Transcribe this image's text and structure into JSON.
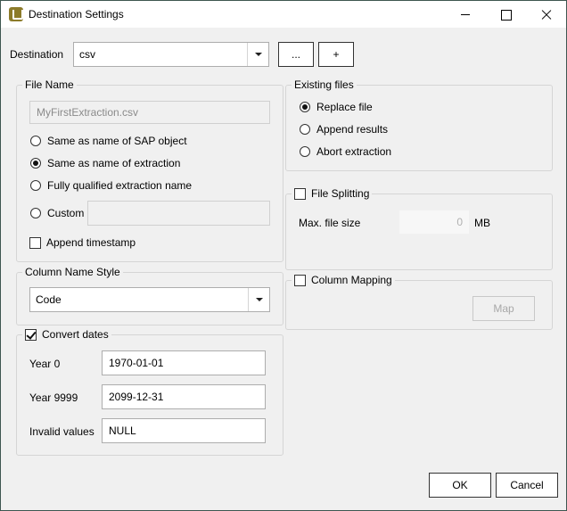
{
  "window": {
    "title": "Destination Settings",
    "icon": "app-logo-icon",
    "controls": [
      "minimize-icon",
      "maximize-icon",
      "close-icon"
    ]
  },
  "destination": {
    "label": "Destination",
    "selected": "csv",
    "browse_label": "...",
    "add_label": "+"
  },
  "file_name": {
    "title": "File Name",
    "preview": "MyFirstExtraction.csv",
    "options": [
      {
        "label": "Same as name of SAP object",
        "checked": false
      },
      {
        "label": "Same as name of extraction",
        "checked": true
      },
      {
        "label": "Fully qualified extraction name",
        "checked": false
      },
      {
        "label": "Custom",
        "checked": false
      }
    ],
    "custom_value": "",
    "append_timestamp": {
      "label": "Append timestamp",
      "checked": false
    }
  },
  "column_name_style": {
    "title": "Column Name Style",
    "selected": "Code"
  },
  "convert_dates": {
    "title": "Convert dates",
    "checked": true,
    "fields": [
      {
        "label": "Year 0",
        "value": "1970-01-01"
      },
      {
        "label": "Year 9999",
        "value": "2099-12-31"
      },
      {
        "label": "Invalid values",
        "value": "NULL"
      }
    ]
  },
  "existing_files": {
    "title": "Existing files",
    "options": [
      {
        "label": "Replace file",
        "checked": true
      },
      {
        "label": "Append results",
        "checked": false
      },
      {
        "label": "Abort extraction",
        "checked": false
      }
    ]
  },
  "file_splitting": {
    "title": "File Splitting",
    "checked": false,
    "max_label": "Max. file size",
    "max_value": "0",
    "unit": "MB"
  },
  "column_mapping": {
    "title": "Column Mapping",
    "checked": false,
    "map_label": "Map"
  },
  "footer": {
    "ok_label": "OK",
    "cancel_label": "Cancel"
  }
}
